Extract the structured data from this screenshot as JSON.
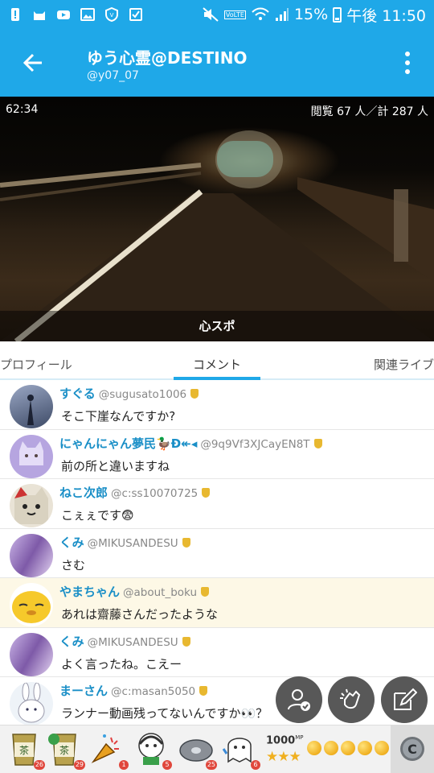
{
  "status_bar": {
    "battery": "15%",
    "time": "午後 11:50",
    "volte": "VoLTE"
  },
  "header": {
    "title": "ゆう心霊@DESTINO",
    "subtitle": "@y07_07"
  },
  "video": {
    "elapsed": "62:34",
    "viewers": "閲覧 67 人／計 287 人",
    "caption": "心スポ"
  },
  "tabs": [
    {
      "label": "プロフィール"
    },
    {
      "label": "コメント"
    },
    {
      "label": "関連ライブ"
    }
  ],
  "comments": [
    {
      "name": "すぐる",
      "user_id": "@sugusato1006",
      "text": "そこ下崖なんですか?"
    },
    {
      "name": "にゃんにゃん夢民🦆Ð↞◂",
      "user_id": "@9q9Vf3XJCayEN8T",
      "text": "前の所と違いますね"
    },
    {
      "name": "ねこ次郎",
      "user_id": "@c:ss10070725",
      "text": "こぇぇです😨"
    },
    {
      "name": "くみ",
      "user_id": "@MIKUSANDESU",
      "text": "さむ"
    },
    {
      "name": "やまちゃん",
      "user_id": "@about_boku",
      "text": "あれは齋藤さんだったような"
    },
    {
      "name": "くみ",
      "user_id": "@MIKUSANDESU",
      "text": "よく言ったね。こえー"
    },
    {
      "name": "まーさん",
      "user_id": "@c:masan5050",
      "text": "ランナー動画残ってないんですか👀？"
    }
  ],
  "items": [
    {
      "name": "tea-cup",
      "label": "茶",
      "count": "26"
    },
    {
      "name": "tea-cup-10",
      "label": "茶",
      "count": "29"
    },
    {
      "name": "party-horn",
      "count": "1"
    },
    {
      "name": "character-dj",
      "count": "5"
    },
    {
      "name": "disc",
      "count": "25"
    },
    {
      "name": "character-ghost",
      "count": "6"
    }
  ],
  "mp": {
    "value": "1000",
    "unit": "MP",
    "stars": "★★★"
  },
  "colors": {
    "accent": "#1fa8e8",
    "name": "#1a8fc7",
    "highlight": "#fdf8e6"
  }
}
